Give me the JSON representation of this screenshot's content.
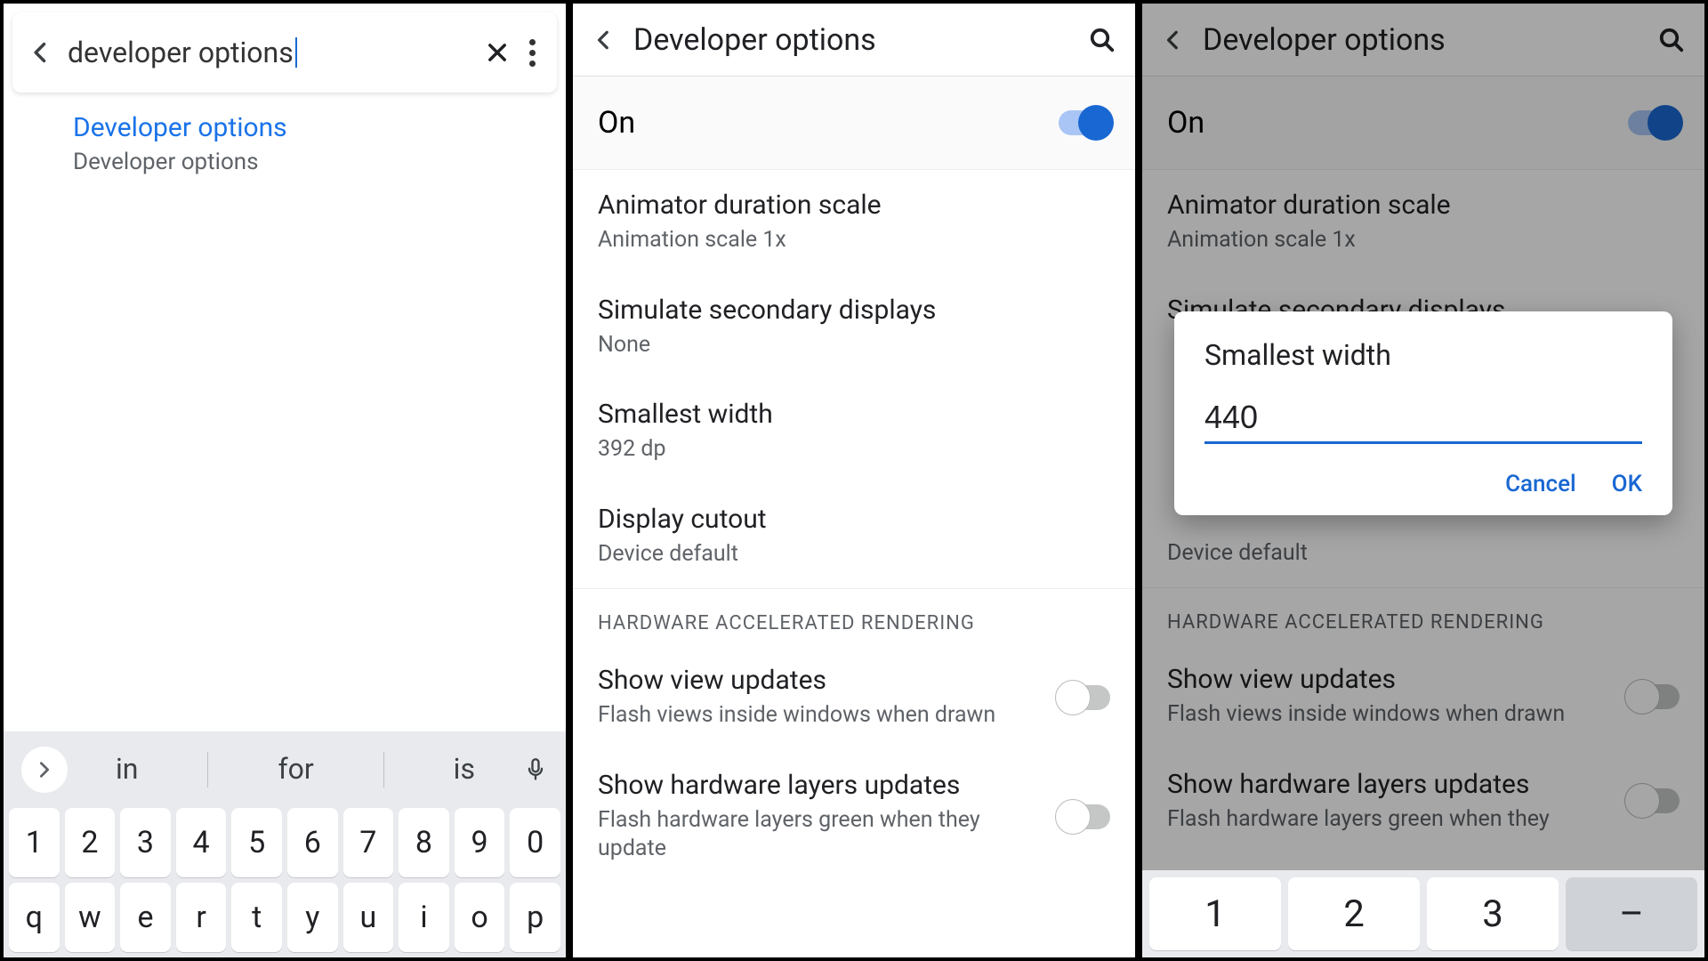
{
  "panel1": {
    "search_value": "developer options",
    "result_title": "Developer options",
    "result_sub": "Developer options",
    "suggestions": [
      "in",
      "for",
      "is"
    ],
    "row_num": [
      "1",
      "2",
      "3",
      "4",
      "5",
      "6",
      "7",
      "8",
      "9",
      "0"
    ],
    "row_q": [
      "q",
      "w",
      "e",
      "r",
      "t",
      "y",
      "u",
      "i",
      "o",
      "p"
    ]
  },
  "panel2": {
    "title": "Developer options",
    "on_label": "On",
    "items": [
      {
        "t1": "Animator duration scale",
        "t2": "Animation scale 1x"
      },
      {
        "t1": "Simulate secondary displays",
        "t2": "None"
      },
      {
        "t1": "Smallest width",
        "t2": "392 dp"
      },
      {
        "t1": "Display cutout",
        "t2": "Device default"
      }
    ],
    "section": "HARDWARE ACCELERATED RENDERING",
    "items2": [
      {
        "t1": "Show view updates",
        "t2": "Flash views inside windows when drawn"
      },
      {
        "t1": "Show hardware layers updates",
        "t2": "Flash hardware layers green when they update"
      }
    ]
  },
  "panel3": {
    "title": "Developer options",
    "on_label": "On",
    "items": [
      {
        "t1": "Animator duration scale",
        "t2": "Animation scale 1x"
      },
      {
        "t1": "Simulate secondary displays",
        "t2": ""
      }
    ],
    "cutout_sub": "Device default",
    "section": "HARDWARE ACCELERATED RENDERING",
    "items2": [
      {
        "t1": "Show view updates",
        "t2": "Flash views inside windows when drawn"
      },
      {
        "t1": "Show hardware layers updates",
        "t2": "Flash hardware layers green when they"
      }
    ],
    "dialog_title": "Smallest width",
    "dialog_value": "440",
    "cancel": "Cancel",
    "ok": "OK",
    "numkeys": [
      "1",
      "2",
      "3",
      "–"
    ]
  }
}
